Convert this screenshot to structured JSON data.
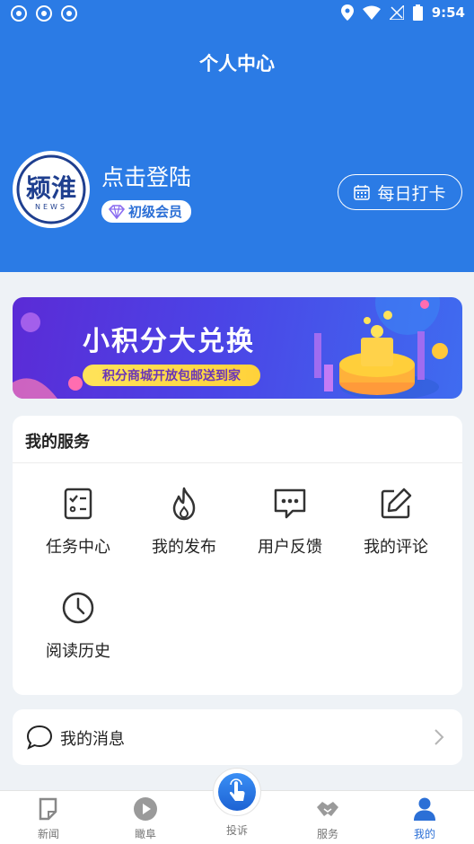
{
  "status_bar": {
    "time": "9:54"
  },
  "header": {
    "title": "个人中心"
  },
  "profile": {
    "login_text": "点击登陆",
    "member_level": "初级会员",
    "checkin_label": "每日打卡",
    "logo_text": "颍淮",
    "logo_sub": "NEWS"
  },
  "banner": {
    "title": "小积分大兑换",
    "subtitle": "积分商城开放包邮送到家"
  },
  "services": {
    "title": "我的服务",
    "items": [
      {
        "label": "任务中心",
        "icon": "task-checklist-icon"
      },
      {
        "label": "我的发布",
        "icon": "flame-icon"
      },
      {
        "label": "用户反馈",
        "icon": "chat-bubble-icon"
      },
      {
        "label": "我的评论",
        "icon": "edit-icon"
      },
      {
        "label": "阅读历史",
        "icon": "clock-icon"
      }
    ]
  },
  "messages": {
    "label": "我的消息"
  },
  "tabbar": {
    "items": [
      {
        "label": "新闻",
        "icon": "news-icon"
      },
      {
        "label": "瞰阜",
        "icon": "play-icon"
      },
      {
        "label": "投诉",
        "icon": "tap-icon"
      },
      {
        "label": "服务",
        "icon": "handshake-icon"
      },
      {
        "label": "我的",
        "icon": "person-icon"
      }
    ],
    "active": "我的",
    "active_color": "#2b6fd6"
  },
  "colors": {
    "header_blue": "#2b7be5",
    "page_bg": "#eef2f6"
  }
}
